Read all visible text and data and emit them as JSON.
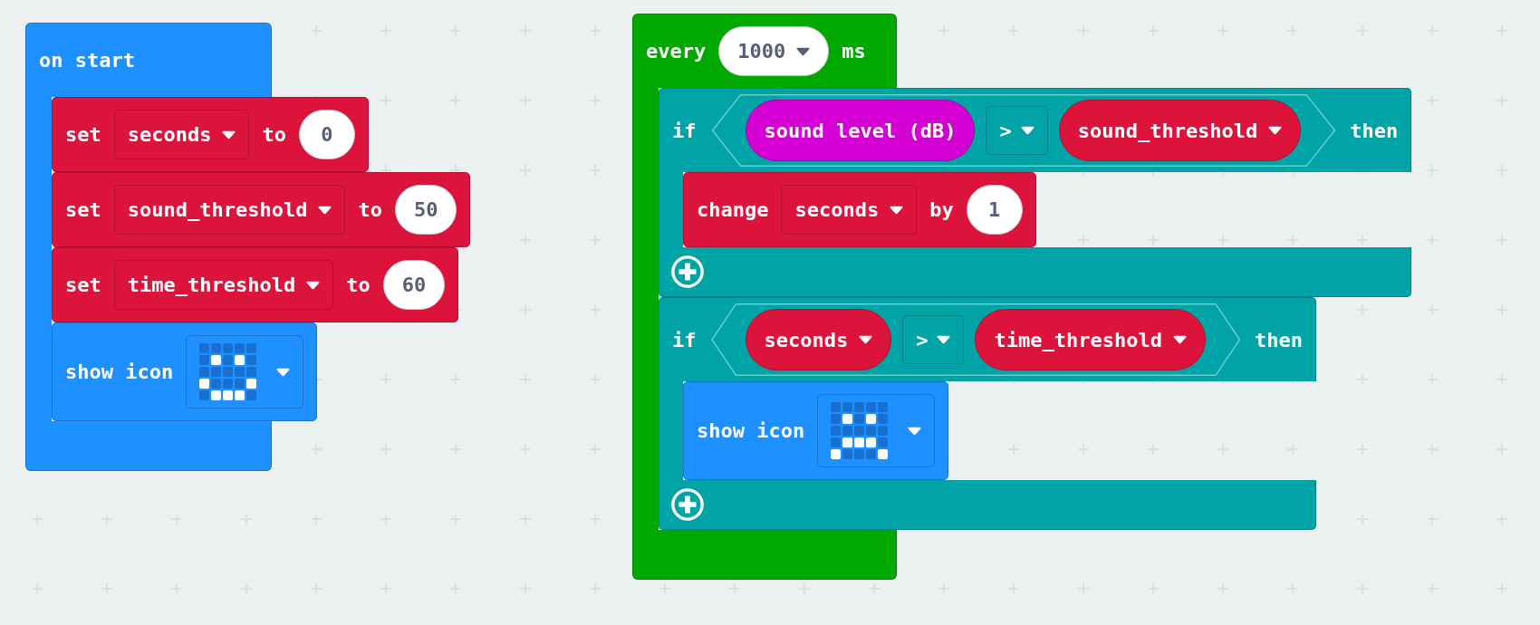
{
  "stacks": [
    {
      "color": "#1e90ff",
      "header": [
        {
          "kind": "label",
          "text": "on start"
        }
      ],
      "body": [
        {
          "kind": "statement",
          "color": "#dc143c",
          "parts": [
            {
              "kind": "label",
              "text": "set"
            },
            {
              "kind": "variable",
              "text": "seconds"
            },
            {
              "kind": "label",
              "text": "to"
            },
            {
              "kind": "number",
              "text": "0"
            }
          ]
        },
        {
          "kind": "statement",
          "color": "#dc143c",
          "parts": [
            {
              "kind": "label",
              "text": "set"
            },
            {
              "kind": "variable",
              "text": "sound_threshold"
            },
            {
              "kind": "label",
              "text": "to"
            },
            {
              "kind": "number",
              "text": "50"
            }
          ]
        },
        {
          "kind": "statement",
          "color": "#dc143c",
          "parts": [
            {
              "kind": "label",
              "text": "set"
            },
            {
              "kind": "variable",
              "text": "time_threshold"
            },
            {
              "kind": "label",
              "text": "to"
            },
            {
              "kind": "number",
              "text": "60"
            }
          ]
        },
        {
          "kind": "statement",
          "color": "#1e90ff",
          "parts": [
            {
              "kind": "label",
              "text": "show icon"
            },
            {
              "kind": "icon",
              "leds": [
                [
                  false,
                  false,
                  false,
                  false,
                  false
                ],
                [
                  false,
                  true,
                  false,
                  true,
                  false
                ],
                [
                  false,
                  false,
                  false,
                  false,
                  false
                ],
                [
                  true,
                  false,
                  false,
                  false,
                  true
                ],
                [
                  false,
                  true,
                  true,
                  true,
                  false
                ]
              ]
            }
          ]
        }
      ]
    },
    {
      "color": "#00a800",
      "header": [
        {
          "kind": "label",
          "text": "every"
        },
        {
          "kind": "number_dropdown",
          "text": "1000"
        },
        {
          "kind": "label",
          "text": "ms"
        }
      ],
      "body": [
        {
          "kind": "if",
          "color": "#00a4a6",
          "add_else": true,
          "parts": [
            {
              "kind": "label",
              "text": "if"
            },
            {
              "kind": "compare",
              "left": {
                "color": "#d400d4",
                "text": "sound level (dB)",
                "dropdown": false
              },
              "operator": ">",
              "right": {
                "color": "#dc143c",
                "text": "sound_threshold",
                "dropdown": true
              }
            },
            {
              "kind": "label",
              "text": "then"
            }
          ],
          "body": [
            {
              "kind": "statement",
              "color": "#dc143c",
              "parts": [
                {
                  "kind": "label",
                  "text": "change"
                },
                {
                  "kind": "variable",
                  "text": "seconds"
                },
                {
                  "kind": "label",
                  "text": "by"
                },
                {
                  "kind": "number",
                  "text": "1"
                }
              ]
            }
          ]
        },
        {
          "kind": "if",
          "color": "#00a4a6",
          "add_else": true,
          "parts": [
            {
              "kind": "label",
              "text": "if"
            },
            {
              "kind": "compare",
              "left": {
                "color": "#dc143c",
                "text": "seconds",
                "dropdown": true
              },
              "operator": ">",
              "right": {
                "color": "#dc143c",
                "text": "time_threshold",
                "dropdown": true
              }
            },
            {
              "kind": "label",
              "text": "then"
            }
          ],
          "body": [
            {
              "kind": "statement",
              "color": "#1e90ff",
              "parts": [
                {
                  "kind": "label",
                  "text": "show icon"
                },
                {
                  "kind": "icon",
                  "leds": [
                    [
                      false,
                      false,
                      false,
                      false,
                      false
                    ],
                    [
                      false,
                      true,
                      false,
                      true,
                      false
                    ],
                    [
                      false,
                      false,
                      false,
                      false,
                      false
                    ],
                    [
                      false,
                      true,
                      true,
                      true,
                      false
                    ],
                    [
                      true,
                      false,
                      false,
                      false,
                      true
                    ]
                  ]
                }
              ]
            }
          ]
        }
      ]
    }
  ]
}
